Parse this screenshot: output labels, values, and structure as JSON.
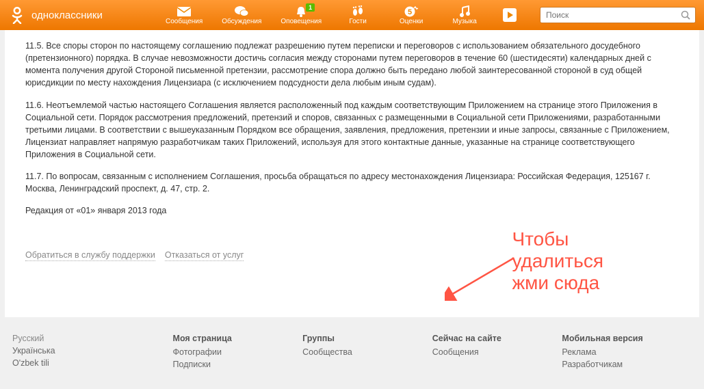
{
  "header": {
    "brand": "одноклассники",
    "nav": [
      {
        "label": "Сообщения",
        "icon": "envelope"
      },
      {
        "label": "Обсуждения",
        "icon": "chat"
      },
      {
        "label": "Оповещения",
        "icon": "bell",
        "badge": "1"
      },
      {
        "label": "Гости",
        "icon": "feet"
      },
      {
        "label": "Оценки",
        "icon": "five"
      },
      {
        "label": "Музыка",
        "icon": "note"
      }
    ],
    "play_icon": "play",
    "search_placeholder": "Поиск"
  },
  "content": {
    "p1": "11.5. Все споры сторон по настоящему соглашению подлежат разрешению путем переписки и переговоров с использованием обязательного досудебного (претензионного) порядка. В случае невозможности достичь согласия между сторонами путем переговоров в течение 60 (шестидесяти) календарных дней с момента получения другой Стороной письменной претензии, рассмотрение спора должно быть передано любой заинтересованной стороной в суд общей юрисдикции по месту нахождения Лицензиара (с исключением подсудности дела любым иным судам).",
    "p2": "11.6. Неотъемлемой частью настоящего Соглашения является расположенный под каждым соответствующим Приложением на странице этого Приложения в Социальной сети. Порядок рассмотрения предложений, претензий и споров, связанных с размещенными в Социальной сети Приложениями, разработанными третьими лицами. В соответствии с вышеуказанным Порядком все обращения, заявления, предложения, претензии и иные запросы, связанные с Приложением, Лицензиат направляет напрямую разработчикам таких Приложений, используя для этого контактные данные, указанные на странице соответствующего Приложения в Социальной сети.",
    "p3": "11.7. По вопросам, связанным с исполнением Соглашения, просьба обращаться по адресу местонахождения Лицензиара: Российская Федерация, 125167 г. Москва, Ленинградский проспект, д. 47, стр. 2.",
    "p4": "Редакция от «01» января 2013 года",
    "link_support": "Обратиться в службу поддержки",
    "link_cancel": "Отказаться от услуг",
    "annotation_l1": "Чтобы",
    "annotation_l2": "удалиться",
    "annotation_l3": "жми сюда"
  },
  "footer": {
    "col1": [
      {
        "text": "Русский",
        "active": true
      },
      {
        "text": "Українська"
      },
      {
        "text": "O'zbek tili"
      }
    ],
    "col2": {
      "head": "Моя страница",
      "items": [
        "Фотографии",
        "Подписки"
      ]
    },
    "col3": {
      "head": "Группы",
      "items": [
        "Сообщества"
      ]
    },
    "col4": {
      "head": "Сейчас на сайте",
      "items": [
        "Сообщения"
      ]
    },
    "col5": {
      "head": "Мобильная версия",
      "items": [
        "Реклама",
        "Разработчикам"
      ]
    }
  }
}
